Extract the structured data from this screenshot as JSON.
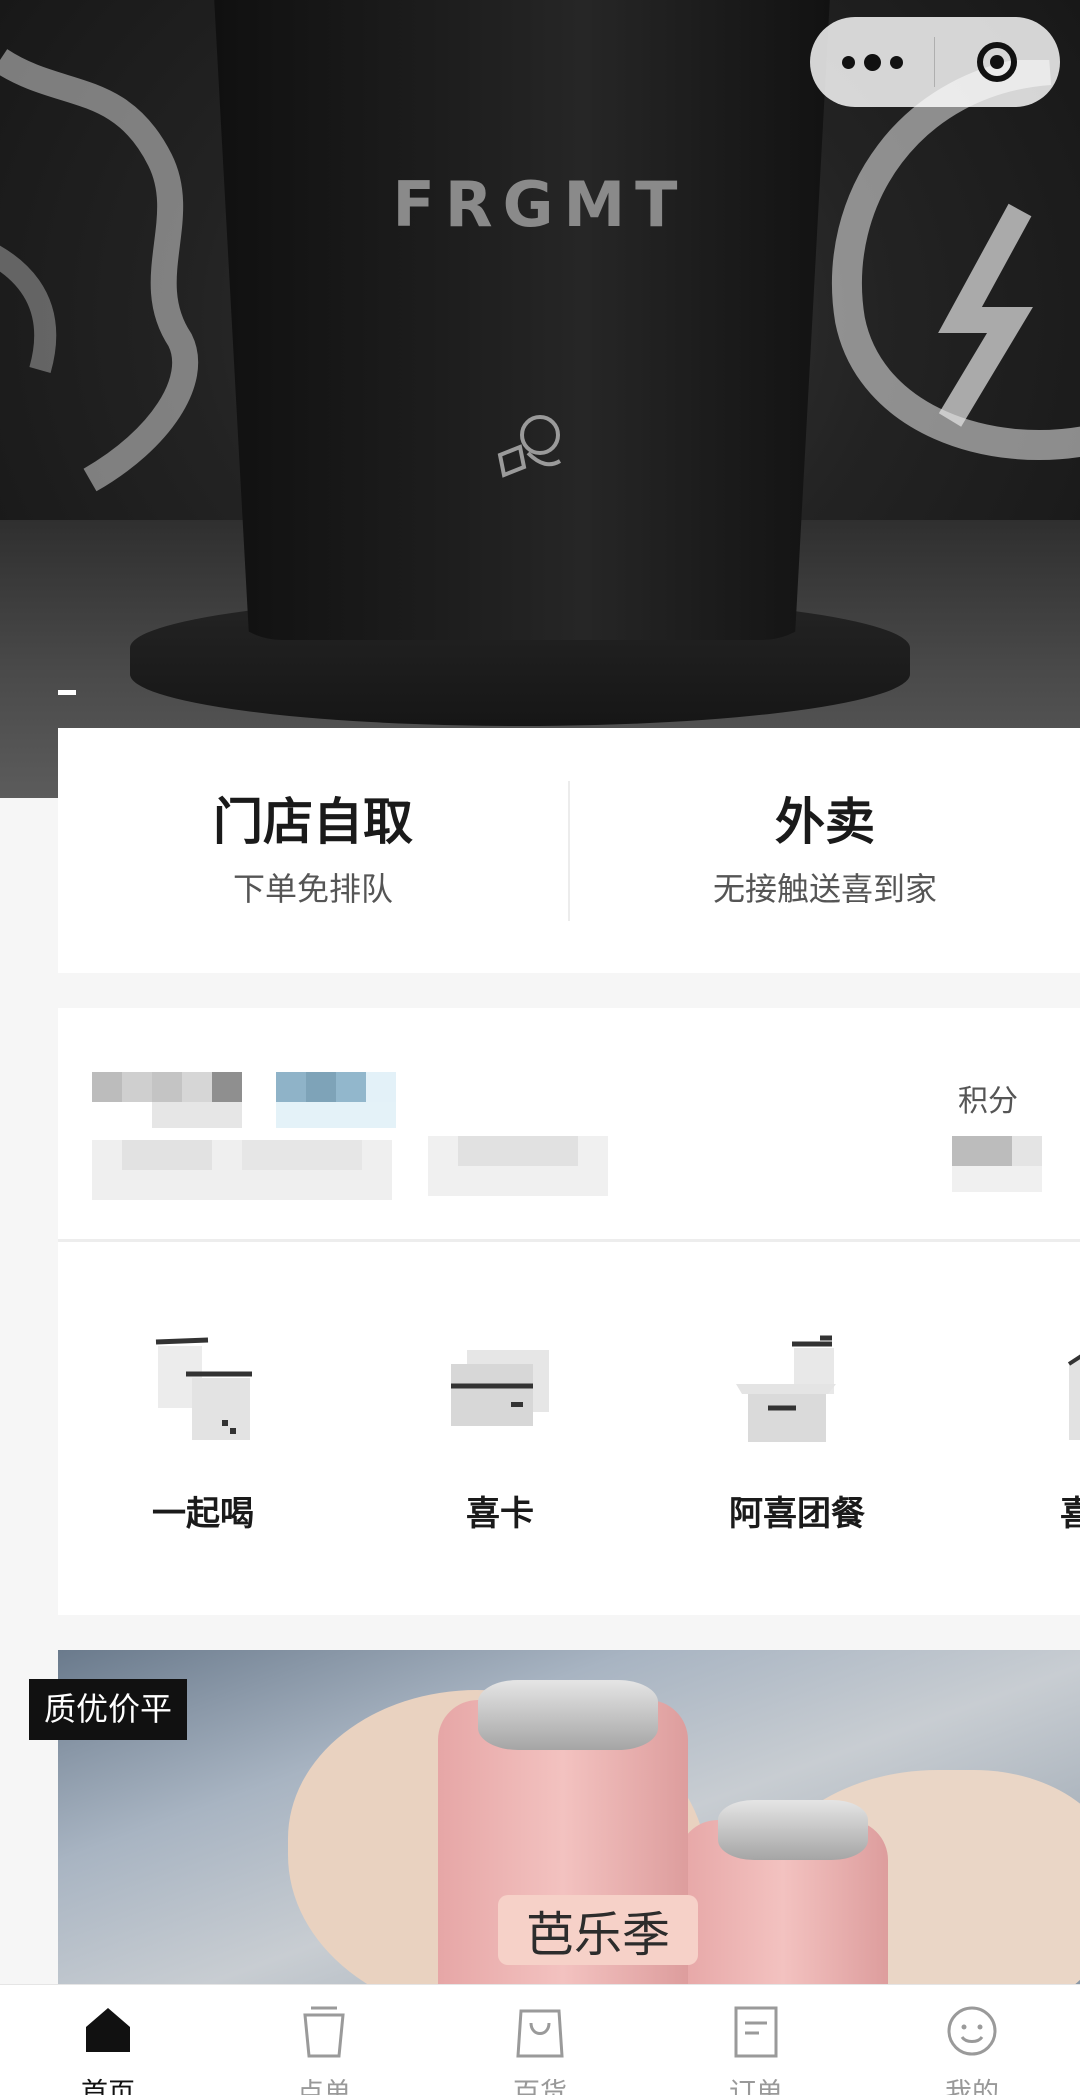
{
  "hero": {
    "brand_text": "FRGMT",
    "slide_index": "1"
  },
  "capsule": {
    "more_icon": "more-dots-icon",
    "close_icon": "target-close-icon"
  },
  "order_modes": [
    {
      "title": "门店自取",
      "subtitle": "下单免排队"
    },
    {
      "title": "外卖",
      "subtitle": "无接触送喜到家"
    }
  ],
  "member": {
    "points_label": "积分"
  },
  "services": [
    {
      "label": "一起喝",
      "icon": "cups-together-icon"
    },
    {
      "label": "喜卡",
      "icon": "gift-card-icon"
    },
    {
      "label": "阿喜团餐",
      "icon": "group-meal-icon"
    },
    {
      "label": "喜茶",
      "icon": "tea-icon"
    }
  ],
  "promo": {
    "tag": "质优价平",
    "jar_label": "芭乐季"
  },
  "tabbar": [
    {
      "label": "首页",
      "icon": "home-icon",
      "active": true
    },
    {
      "label": "点单",
      "icon": "cup-icon",
      "active": false
    },
    {
      "label": "百货",
      "icon": "shopping-bag-icon",
      "active": false
    },
    {
      "label": "订单",
      "icon": "order-list-icon",
      "active": false
    },
    {
      "label": "我的",
      "icon": "smiley-icon",
      "active": false
    }
  ]
}
